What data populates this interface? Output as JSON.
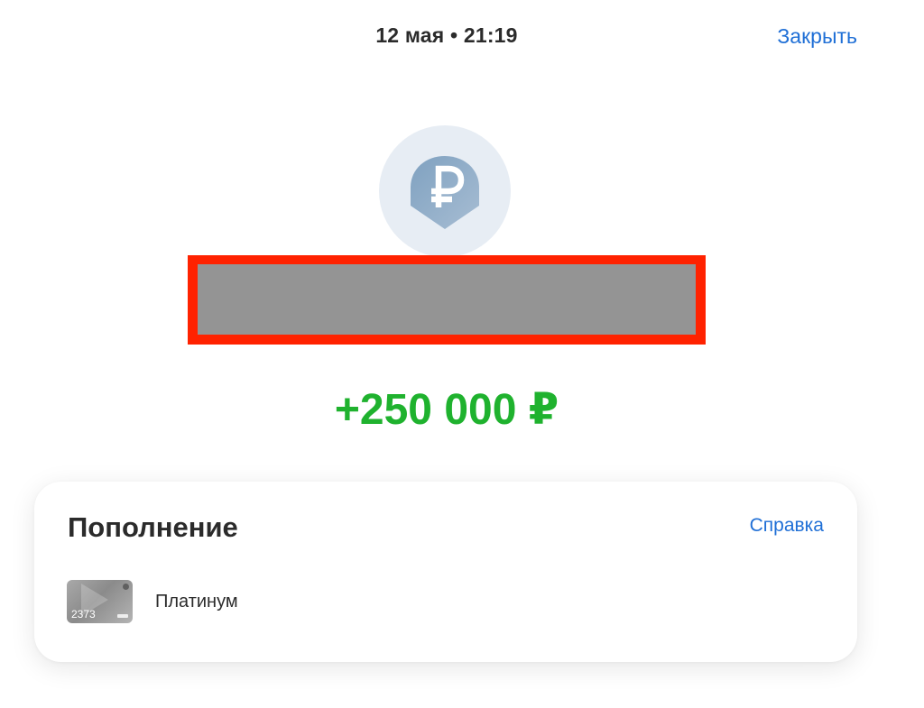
{
  "header": {
    "datetime": "12 мая • 21:19",
    "close_label": "Закрыть"
  },
  "operation": {
    "icon": "ruble-icon",
    "amount": "+250 000 ₽",
    "amount_color": "#1fb22e"
  },
  "details_card": {
    "title": "Пополнение",
    "help_label": "Справка",
    "account": {
      "card_last_digits": "2373",
      "name": "Платинум"
    }
  },
  "colors": {
    "link": "#1f6fd6",
    "redaction_border": "#ff2200",
    "redaction_fill": "#949494",
    "logo_bg": "#e7edf4"
  }
}
